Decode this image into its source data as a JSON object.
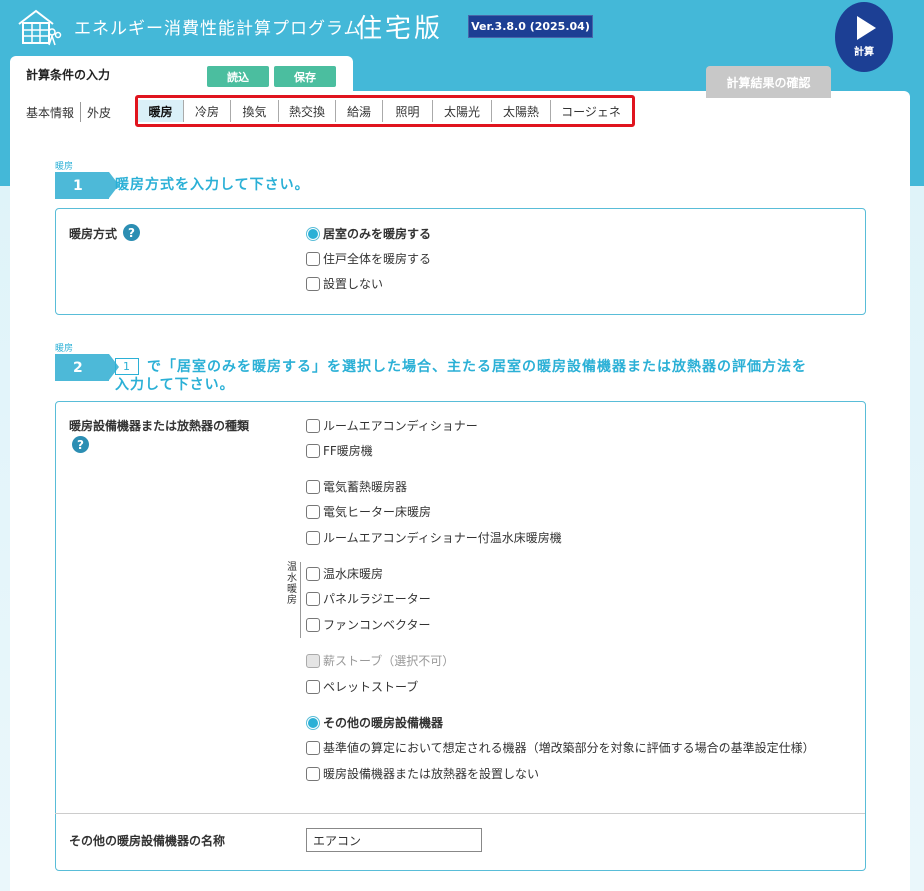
{
  "header": {
    "title": "エネルギー消費性能計算プログラム",
    "subtitle": "住宅版",
    "version": "Ver.3.8.0 (2025.04)",
    "calc_label": "計算"
  },
  "tabs_top": {
    "input_label": "計算条件の入力",
    "load_label": "読込",
    "save_label": "保存",
    "result_label": "計算結果の確認"
  },
  "subnav": {
    "items": [
      "基本情報",
      "外皮"
    ],
    "tabs": [
      "暖房",
      "冷房",
      "換気",
      "熱交換",
      "給湯",
      "照明",
      "太陽光",
      "太陽熱",
      "コージェネ"
    ],
    "active_tab": "暖房"
  },
  "section1": {
    "small": "暖房",
    "num": "1",
    "title": "暖房方式を入力して下さい。",
    "field_label": "暖房方式",
    "options": [
      "居室のみを暖房する",
      "住戸全体を暖房する",
      "設置しない"
    ],
    "selected": "居室のみを暖房する"
  },
  "section2": {
    "small": "暖房",
    "num": "2",
    "ref": "1",
    "title_line1": "で「居室のみを暖房する」を選択した場合、主たる居室の暖房設備機器または放熱器の評価方法を",
    "title_line2": "入力して下さい。",
    "field_label": "暖房設備機器または放熱器の種類",
    "group1": [
      "ルームエアコンディショナー",
      "FF暖房機"
    ],
    "group2": [
      "電気蓄熱暖房器",
      "電気ヒーター床暖房",
      "ルームエアコンディショナー付温水床暖房機"
    ],
    "hot_water_label": "温水暖房",
    "group3": [
      "温水床暖房",
      "パネルラジエーター",
      "ファンコンベクター"
    ],
    "group4": [
      "薪ストーブ（選択不可）",
      "ペレットストーブ"
    ],
    "group5": [
      "その他の暖房設備機器",
      "基準値の算定において想定される機器（増改築部分を対象に評価する場合の基準設定仕様）",
      "暖房設備機器または放熱器を設置しない"
    ],
    "selected": "その他の暖房設備機器",
    "other_name_label": "その他の暖房設備機器の名称",
    "other_name_value": "エアコン"
  }
}
